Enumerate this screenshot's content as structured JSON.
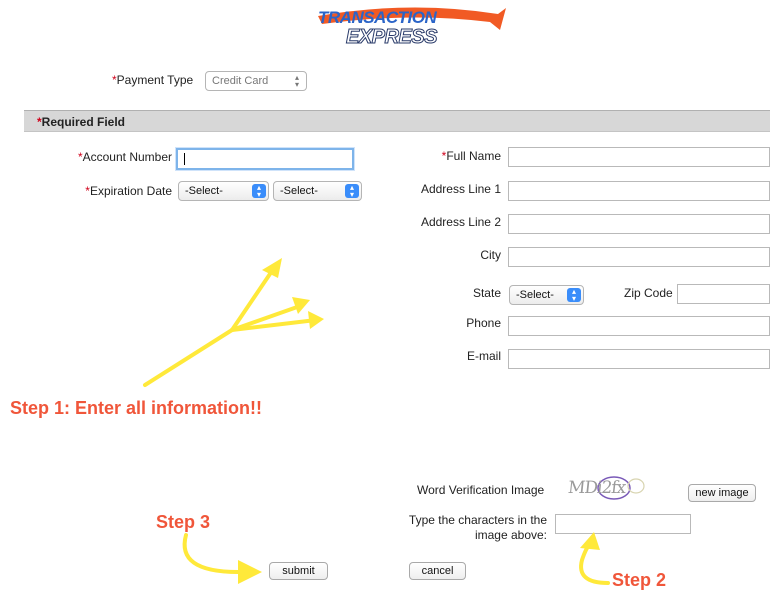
{
  "logo": {
    "line1": "TRANSACTION",
    "line2": "EXPRESS",
    "colors": {
      "blue": "#2a64c8",
      "orange": "#f15a24"
    }
  },
  "payment": {
    "label": "Payment Type",
    "value": "Credit Card"
  },
  "required_band": {
    "label": "Required Field"
  },
  "left_form": {
    "account_number_label": "Account Number",
    "account_number_value": "",
    "expiration_label": "Expiration Date",
    "exp_month": "-Select-",
    "exp_year": "-Select-"
  },
  "right_form": {
    "full_name_label": "Full Name",
    "address1_label": "Address Line 1",
    "address2_label": "Address Line 2",
    "city_label": "City",
    "state_label": "State",
    "state_value": "-Select-",
    "zip_label": "Zip Code",
    "phone_label": "Phone",
    "email_label": "E-mail"
  },
  "verification": {
    "image_label": "Word Verification Image",
    "captcha_text": "MDi2fx",
    "new_image_button": "new image",
    "type_label_line1": "Type the characters in the",
    "type_label_line2": "image above:"
  },
  "buttons": {
    "submit": "submit",
    "cancel": "cancel"
  },
  "annotations": {
    "step1": "Step 1: Enter all information!!",
    "step2": "Step 2",
    "step3": "Step 3",
    "colors": {
      "arrow": "#ffe93a",
      "text": "#f0563a"
    }
  }
}
